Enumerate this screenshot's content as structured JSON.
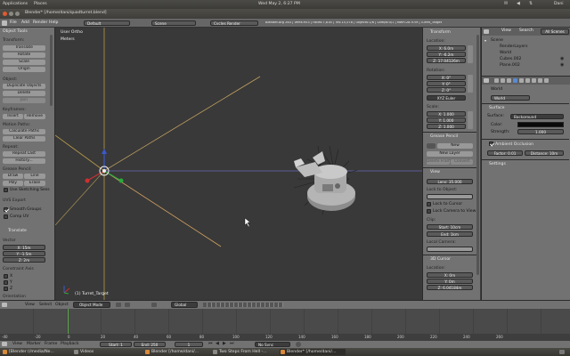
{
  "topbar": {
    "menu_applications": "Applications",
    "menu_places": "Places",
    "clock": "Wed May 2,  6:27 PM",
    "user": "Dani"
  },
  "window": {
    "title": "Blender* [/home/dani/quadturret.blend]"
  },
  "infobar": {
    "menus": [
      "File",
      "Add",
      "Render",
      "Help"
    ],
    "layout": "Default",
    "scene": "Scene",
    "engine": "Cycles Render",
    "stats": "Blender-org 263 | Verts:953 | Faces:7,816 | Tris:15,578 | Objects:1/6 | Lamps:0/1 | Mem:28.97M | Turret_Target"
  },
  "toolshelf": {
    "title": "Object Tools",
    "transform_label": "Transform:",
    "transform_buttons": [
      "Translate",
      "Rotate",
      "Scale",
      "Origin"
    ],
    "object_label": "Object:",
    "object_buttons": [
      "Duplicate Objects",
      "Delete",
      "Join"
    ],
    "keyframes_label": "Keyframes:",
    "keyframe_insert": "Insert",
    "keyframe_remove": "Remove",
    "motion_label": "Motion Paths:",
    "motion_buttons": [
      "Calculate Paths",
      "Clear Paths"
    ],
    "repeat_label": "Repeat:",
    "repeat_buttons": [
      "Repeat Last",
      "History..."
    ],
    "grease_label": "Grease Pencil:",
    "grease_draw": "Draw",
    "grease_line": "Line",
    "grease_poly": "Poly",
    "grease_erase": "Erase",
    "grease_checkbox": "Use Sketching Sess",
    "uv_label": "UVS Export",
    "smooth_groups": "Smooth Groups",
    "comp_uv": "Comp UV",
    "translate_section": "Translate",
    "vector_label": "Vector",
    "vector": [
      "X: 15m",
      "Y: -1.5m",
      "Z: 2m"
    ],
    "constraint_label": "Constraint Axis",
    "constraint_axes": [
      "X",
      "Y",
      "Z"
    ],
    "orientation_label": "Orientation"
  },
  "viewport": {
    "view_label": "User Ortho",
    "units_label": "Meters",
    "object_label": "(1) Turret_Target"
  },
  "npanel": {
    "transform_title": "Transform",
    "location_label": "Location:",
    "location": [
      "X: 6.0m",
      "Y: -6.2m",
      "Z: 17.04126m"
    ],
    "rotation_label": "Rotation:",
    "rotation": [
      "X: 0°",
      "Y: 0°",
      "Z: 0°"
    ],
    "rotation_mode": "XYZ Euler",
    "scale_label": "Scale:",
    "scale": [
      "X: 1.000",
      "Y: 1.000",
      "Z: 1.000"
    ],
    "grease_title": "Grease Pencil",
    "grease_new": "New",
    "grease_new_layer": "New Layer",
    "grease_delete_frame": "Delete Frame",
    "grease_convert": "Convert",
    "view_title": "View",
    "lens": "Lens: 35.000",
    "lock_label": "Lock to Object:",
    "lock_cursor": "Lock to Cursor",
    "lock_camera": "Lock Camera to View",
    "clip_label": "Clip:",
    "clip_start": "Start: 10cm",
    "clip_end": "End: 1km",
    "local_camera": "Local Camera:",
    "cursor_title": "3D Cursor",
    "cursor_location_label": "Location:",
    "cursor_location": [
      "X: 0m",
      "Y: 0m",
      "Z: 6.04184m"
    ]
  },
  "outliner": {
    "view": "View",
    "search": "Search",
    "filter": "All Scenes",
    "items": [
      "Scene",
      "RenderLayers",
      "World",
      "Cubes.002",
      "Plane.002"
    ]
  },
  "properties": {
    "breadcrumb": "World",
    "world_name": "World",
    "surface_title": "Surface",
    "surface_label": "Surface:",
    "surface_value": "Background",
    "color_label": "Color:",
    "strength_label": "Strength:",
    "strength_value": "1.000",
    "ao_label": "Ambient Occlusion",
    "ao_factor": "Factor: 0.01",
    "ao_distance": "Distance: 10m",
    "settings_label": "Settings"
  },
  "viewport_header": {
    "view": "View",
    "select": "Select",
    "object": "Object",
    "mode": "Object Mode",
    "pivot": "Global"
  },
  "timeline": {
    "ticks": [
      "-40",
      "-20",
      "0",
      "20",
      "40",
      "60",
      "80",
      "100",
      "120",
      "140",
      "160",
      "180",
      "200",
      "220",
      "240",
      "260"
    ],
    "menus": [
      "View",
      "Marker",
      "Frame",
      "Playback"
    ],
    "start": "Start: 1",
    "end": "End: 250",
    "current": "1",
    "sync": "No Sync"
  },
  "taskbar": {
    "items": [
      "[Blender (/media/Ne...",
      "Videos",
      "Blender [/home/dani/...",
      "Two Steps From Hell -...",
      "Blender* [/home/dani/..."
    ]
  },
  "colors": {
    "accent": "#d88a3a",
    "panel": "#727272",
    "viewport": "#393939"
  }
}
